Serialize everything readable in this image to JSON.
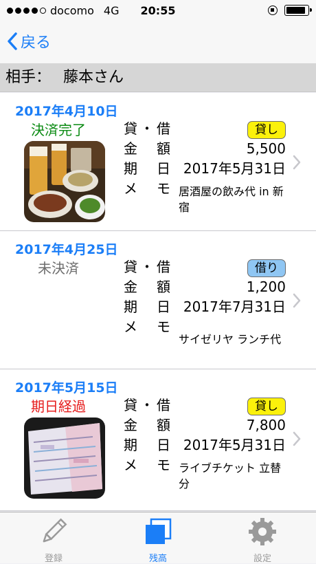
{
  "status_bar": {
    "carrier": "docomo",
    "network": "4G",
    "time": "20:55"
  },
  "nav": {
    "back_label": "戻る"
  },
  "header": {
    "label": "相手：",
    "name": "藤本さん"
  },
  "field_labels": {
    "type": [
      "貸",
      "・",
      "借"
    ],
    "amount": [
      "金",
      "額"
    ],
    "due": [
      "期",
      "日"
    ],
    "memo": [
      "メ",
      "モ"
    ]
  },
  "records": [
    {
      "date": "2017年4月10日",
      "status": "決済完了",
      "type": "貸し",
      "amount": "5,500",
      "due": "2017年5月31日",
      "memo": "居酒屋の飲み代 in 新宿",
      "thumb_icon": "food-photo"
    },
    {
      "date": "2017年4月25日",
      "status": "未決済",
      "type": "借り",
      "amount": "1,200",
      "due": "2017年7月31日",
      "memo": "サイゼリヤ ランチ代",
      "thumb_icon": ""
    },
    {
      "date": "2017年5月15日",
      "status": "期日経過",
      "type": "貸し",
      "amount": "7,800",
      "due": "2017年5月31日",
      "memo": "ライブチケット 立替分",
      "thumb_icon": "ticket-photo"
    }
  ],
  "tabs": [
    {
      "label": "登録",
      "icon": "pencil-icon"
    },
    {
      "label": "残高",
      "icon": "balance-icon"
    },
    {
      "label": "設定",
      "icon": "gear-icon"
    }
  ],
  "colors": {
    "accent": "#1b7ef7",
    "lend_badge": "#fbf10b",
    "borrow_badge": "#8fc6f3",
    "done": "#0a8a12",
    "overdue": "#e61d1d"
  }
}
